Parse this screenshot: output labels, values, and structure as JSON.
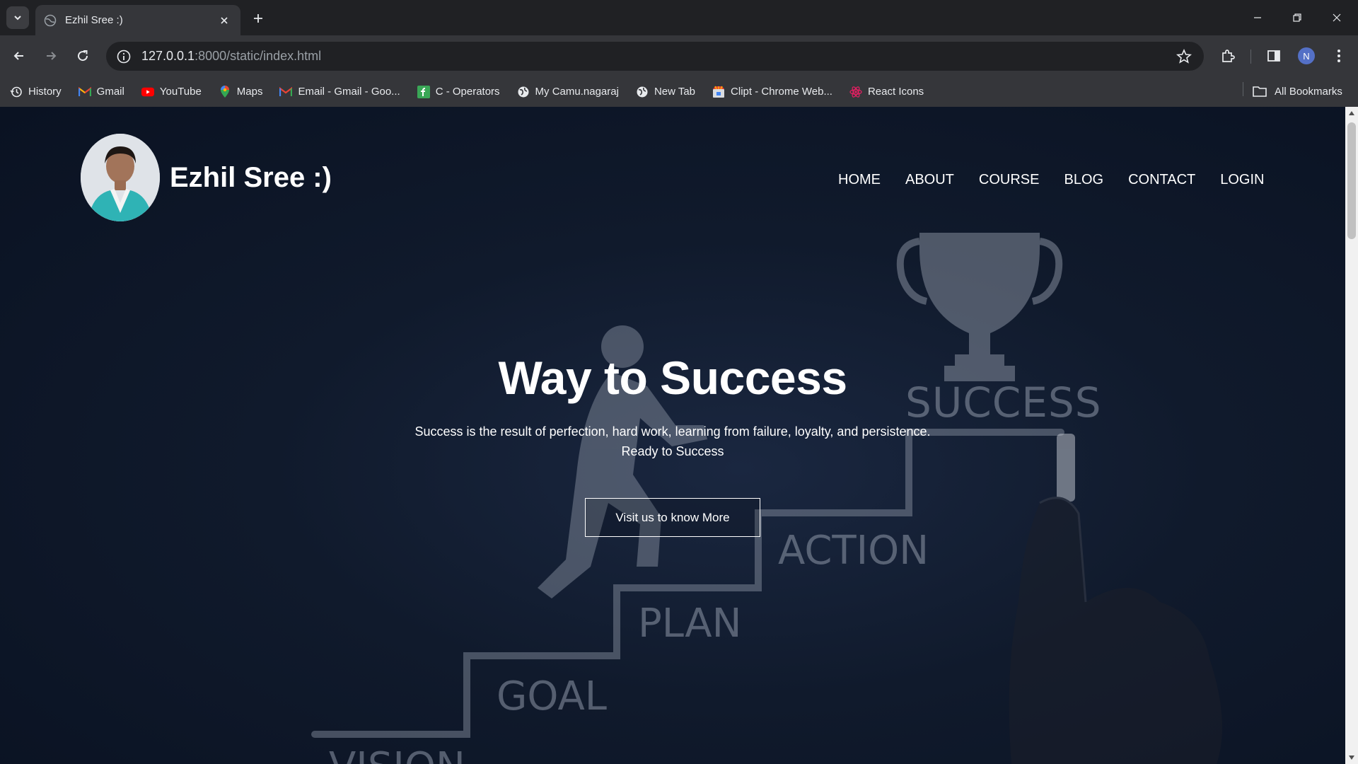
{
  "browser": {
    "tab_title": "Ezhil Sree :)",
    "url_host": "127.0.0.1",
    "url_rest": ":8000/static/index.html",
    "profile_initial": "N",
    "bookmarks": [
      {
        "label": "History",
        "icon": "history-icon"
      },
      {
        "label": "Gmail",
        "icon": "gmail-icon"
      },
      {
        "label": "YouTube",
        "icon": "youtube-icon"
      },
      {
        "label": "Maps",
        "icon": "maps-icon"
      },
      {
        "label": "Email - Gmail - Goo...",
        "icon": "gmail-icon"
      },
      {
        "label": "C - Operators",
        "icon": "operators-icon"
      },
      {
        "label": "My Camu.nagaraj",
        "icon": "globe-icon"
      },
      {
        "label": "New Tab",
        "icon": "globe-icon"
      },
      {
        "label": "Clipt - Chrome Web...",
        "icon": "clipt-icon"
      },
      {
        "label": "React Icons",
        "icon": "react-icon"
      }
    ],
    "all_bookmarks": "All Bookmarks"
  },
  "page": {
    "brand_name": "Ezhil Sree :)",
    "nav": [
      "HOME",
      "ABOUT",
      "COURSE",
      "BLOG",
      "CONTACT",
      "LOGIN"
    ],
    "hero": {
      "title": "Way to Success",
      "text_line1": "Success is the result of perfection, hard work, learning from failure, loyalty, and persistence.",
      "text_line2": "Ready to Success",
      "cta_label": "Visit us to know More"
    },
    "background_words": [
      "SUCCESS",
      "ACTION",
      "PLAN",
      "GOAL",
      "VISION"
    ]
  },
  "colors": {
    "page_bg": "#101a2c",
    "chrome_bg": "#35363a",
    "tabstrip_bg": "#202124",
    "text_white": "#ffffff"
  }
}
